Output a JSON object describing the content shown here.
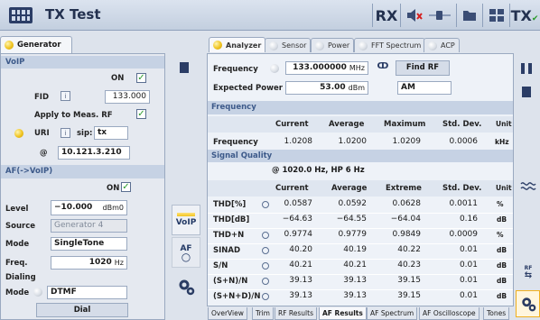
{
  "title_bar": {
    "title": "TX Test",
    "rx_label": "RX",
    "tx_label": "TX"
  },
  "left_tab": {
    "label": "Generator"
  },
  "voip": {
    "section": "VoIP",
    "on_label": "ON",
    "fid_label": "FID",
    "fid_box": "i",
    "fid_value": "133.000",
    "apply_label": "Apply to Meas. RF",
    "uri_label": "URI",
    "uri_box": "i",
    "sip_label": "sip:",
    "sip_value": "tx",
    "at_label": "@",
    "ip_value": "10.121.3.210"
  },
  "af": {
    "section": "AF(->VoIP)",
    "on_label": "ON",
    "level_label": "Level",
    "level_value": "−10.000",
    "level_unit": "dBm0",
    "source_label": "Source",
    "source_value": "Generator 4",
    "mode_label": "Mode",
    "mode_value": "SingleTone",
    "freq_label": "Freq.",
    "freq_value": "1020",
    "freq_unit": "Hz",
    "dialing_label": "Dialing",
    "dial_mode_label": "Mode",
    "dial_mode_value": "DTMF",
    "dial_button": "Dial"
  },
  "mid_buttons": {
    "voip": "VoIP",
    "af": "AF"
  },
  "top_tabs": [
    "Analyzer",
    "Sensor",
    "Power",
    "FFT Spectrum",
    "ACP"
  ],
  "analyzer": {
    "freq_label": "Frequency",
    "freq_value": "133.000000",
    "freq_unit": "MHz",
    "find_rf": "Find RF",
    "exp_power_label": "Expected Power",
    "exp_power_value": "53.00",
    "exp_power_unit": "dBm",
    "mod_value": "AM"
  },
  "freq_table": {
    "section": "Frequency",
    "headers": [
      "Current",
      "Average",
      "Maximum",
      "Std. Dev.",
      "Unit"
    ],
    "row": {
      "label": "Frequency",
      "values": [
        "1.0208",
        "1.0200",
        "1.0209",
        "0.0006",
        "kHz"
      ]
    }
  },
  "sq_table": {
    "section": "Signal Quality",
    "subtitle": "@ 1020.0 Hz, HP 6 Hz",
    "headers": [
      "Current",
      "Average",
      "Extreme",
      "Std. Dev.",
      "Unit"
    ],
    "rows": [
      {
        "label": "THD[%]",
        "dot": true,
        "values": [
          "0.0587",
          "0.0592",
          "0.0628",
          "0.0011",
          "%"
        ]
      },
      {
        "label": "THD[dB]",
        "dot": false,
        "values": [
          "−64.63",
          "−64.55",
          "−64.04",
          "0.16",
          "dB"
        ]
      },
      {
        "label": "THD+N",
        "dot": true,
        "values": [
          "0.9774",
          "0.9779",
          "0.9849",
          "0.0009",
          "%"
        ]
      },
      {
        "label": "SINAD",
        "dot": true,
        "values": [
          "40.20",
          "40.19",
          "40.22",
          "0.01",
          "dB"
        ]
      },
      {
        "label": "S/N",
        "dot": true,
        "values": [
          "40.21",
          "40.21",
          "40.23",
          "0.01",
          "dB"
        ]
      },
      {
        "label": "(S+N)/N",
        "dot": true,
        "values": [
          "39.13",
          "39.13",
          "39.15",
          "0.01",
          "dB"
        ]
      },
      {
        "label": "(S+N+D)/N",
        "dot": true,
        "values": [
          "39.13",
          "39.13",
          "39.15",
          "0.01",
          "dB"
        ]
      }
    ]
  },
  "bottom_tabs": [
    "OverView",
    "Trim",
    "RF Results",
    "AF Results",
    "AF Spectrum",
    "AF Oscilloscope",
    "Tones"
  ],
  "active_bottom_tab": "AF Results",
  "right_buttons": {
    "rf_label": "RF"
  },
  "colors": {
    "accent": "#3d5a8a",
    "header_band": "#c6d2e4",
    "active_dot": "#f0c420",
    "check": "#2a9a2a",
    "mute_x": "#d42020"
  }
}
